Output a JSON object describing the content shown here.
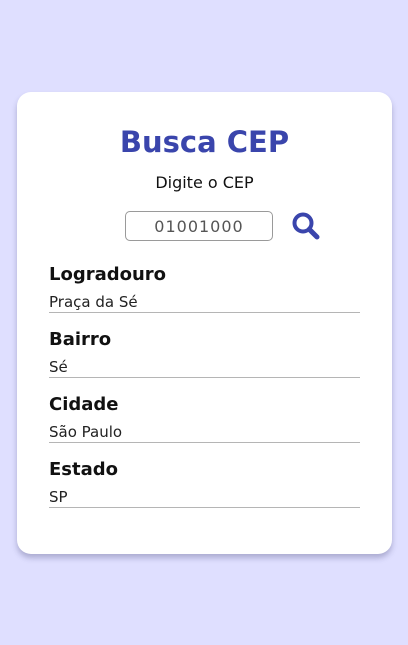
{
  "app": {
    "title": "Busca CEP",
    "subtitle": "Digite o CEP"
  },
  "search": {
    "cep_value": "01001000",
    "icon": "search-icon",
    "accent_color": "#3a45ac"
  },
  "fields": {
    "logradouro": {
      "label": "Logradouro",
      "value": "Praça da Sé"
    },
    "bairro": {
      "label": "Bairro",
      "value": "Sé"
    },
    "cidade": {
      "label": "Cidade",
      "value": "São Paulo"
    },
    "estado": {
      "label": "Estado",
      "value": "SP"
    }
  },
  "colors": {
    "background": "#dfdfff",
    "card": "#ffffff"
  }
}
